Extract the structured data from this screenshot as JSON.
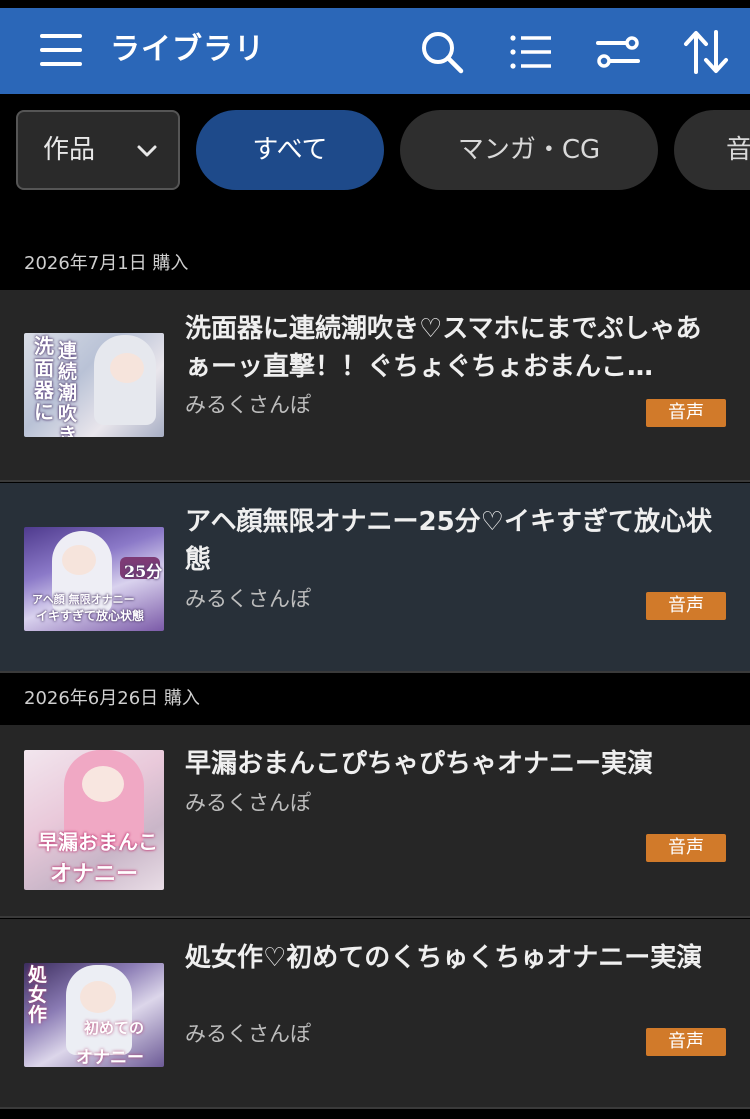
{
  "appbar": {
    "title": "ライブラリ",
    "icons": [
      "menu-icon",
      "search-icon",
      "list-icon",
      "filter-icon",
      "sort-icon"
    ],
    "color": "#2b67b8"
  },
  "filters": {
    "category_select": "作品",
    "chips": [
      {
        "label": "すべて",
        "active": true
      },
      {
        "label": "マンガ・CG",
        "active": false
      },
      {
        "label": "音",
        "active": false
      }
    ]
  },
  "sections": [
    {
      "date_label": "2026年7月1日 購入",
      "items": [
        {
          "title": "洗面器に連続潮吹き♡スマホにまでぷしゃあぁーッ直撃！！ぐちょぐちょおまんこ…",
          "author": "みるくさんぽ",
          "badge": "音声",
          "thumb_text": "洗面器に 連続潮吹き"
        },
        {
          "title": "アヘ顔無限オナニー25分♡イキすぎて放心状態",
          "author": "みるくさんぽ",
          "badge": "音声",
          "thumb_text": "アヘ顔 無限オナニー イキすぎて放心状態"
        }
      ]
    },
    {
      "date_label": "2026年6月26日 購入",
      "items": [
        {
          "title": "早漏おまんこぴちゃぴちゃオナニー実演",
          "author": "みるくさんぽ",
          "badge": "音声",
          "thumb_text": "早漏おまんこ オナニー"
        },
        {
          "title": "処女作♡初めてのくちゅくちゅオナニー実演",
          "author": "みるくさんぽ",
          "badge": "音声",
          "thumb_text": "処女作 初めての オナニー"
        }
      ]
    }
  ],
  "colors": {
    "badge": "#d17a2a",
    "active_chip": "#1e4a8a",
    "item_bg": "#262626",
    "item_highlight_bg": "#283039"
  }
}
